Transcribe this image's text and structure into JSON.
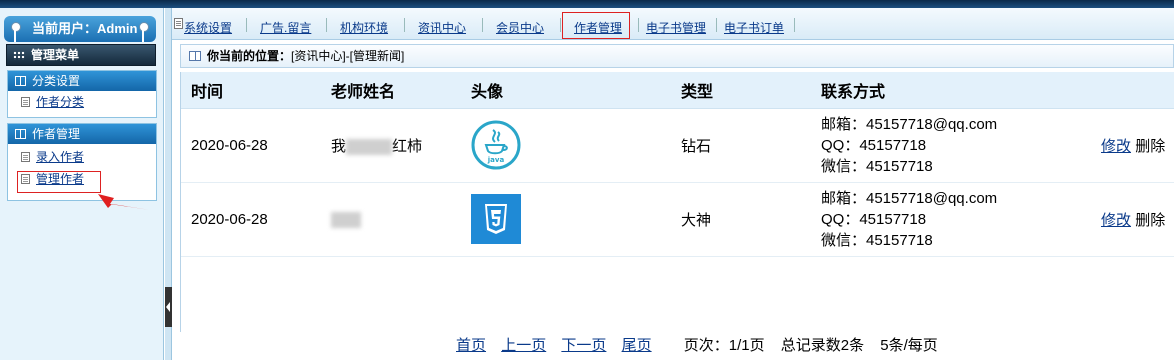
{
  "sidebar": {
    "user_label": "当前用户：Admin",
    "menu_title": "管理菜单",
    "sections": [
      {
        "title": "分类设置",
        "items": [
          "作者分类"
        ]
      },
      {
        "title": "作者管理",
        "items": [
          "录入作者",
          "管理作者"
        ]
      }
    ]
  },
  "nav": {
    "items": [
      "系统设置",
      "广告.留言",
      "机构环境",
      "资讯中心",
      "会员中心",
      "作者管理",
      "电子书管理",
      "电子书订单"
    ],
    "active": "作者管理"
  },
  "breadcrumb": {
    "label": "你当前的位置：",
    "path": "[资讯中心]-[管理新闻]"
  },
  "table": {
    "headers": [
      "时间",
      "老师姓名",
      "头像",
      "类型",
      "联系方式"
    ],
    "rows": [
      {
        "time": "2020-06-28",
        "name_prefix": "我",
        "name_suffix": "红柿",
        "avatar": "java-icon",
        "type": "钻石",
        "email": "邮箱：45157718@qq.com",
        "qq": "QQ：45157718",
        "wechat": "微信：45157718",
        "edit": "修改",
        "delete": "删除"
      },
      {
        "time": "2020-06-28",
        "name_prefix": "",
        "name_suffix": "",
        "avatar": "css3-icon",
        "type": "大神",
        "email": "邮箱：45157718@qq.com",
        "qq": "QQ：45157718",
        "wechat": "微信：45157718",
        "edit": "修改",
        "delete": "删除"
      }
    ]
  },
  "pager": {
    "first": "首页",
    "prev": "上一页",
    "next": "下一页",
    "last": "尾页",
    "page_info": "页次：1/1页",
    "total": "总记录数2条",
    "per_page": "5条/每页"
  },
  "colors": {
    "accent": "#1b6fb2",
    "link": "#0a3a8a",
    "highlight": "#dd2222",
    "header_bg": "#e3f1fb"
  }
}
